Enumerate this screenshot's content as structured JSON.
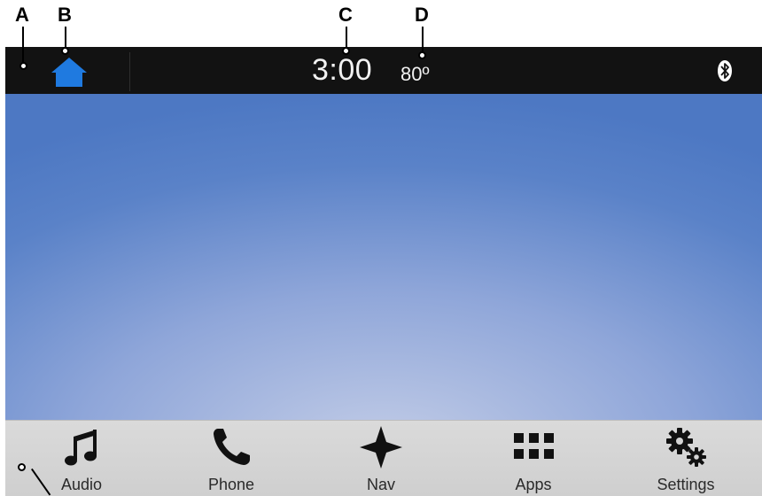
{
  "callouts": [
    "A",
    "B",
    "C",
    "D"
  ],
  "status_bar": {
    "time": "3:00",
    "temperature": "80º",
    "home_icon": "home-icon",
    "bluetooth_icon": "bluetooth-icon",
    "home_color": "#1f7ae0"
  },
  "dock": {
    "items": [
      {
        "label": "Audio",
        "icon": "music-note-icon"
      },
      {
        "label": "Phone",
        "icon": "phone-icon"
      },
      {
        "label": "Nav",
        "icon": "compass-star-icon"
      },
      {
        "label": "Apps",
        "icon": "apps-grid-icon"
      },
      {
        "label": "Settings",
        "icon": "gears-icon"
      }
    ]
  },
  "colors": {
    "status_bar": "#121212",
    "background_top": "#4d78c3",
    "background_bottom": "#c3cde7",
    "dock": "#d4d4d4"
  }
}
